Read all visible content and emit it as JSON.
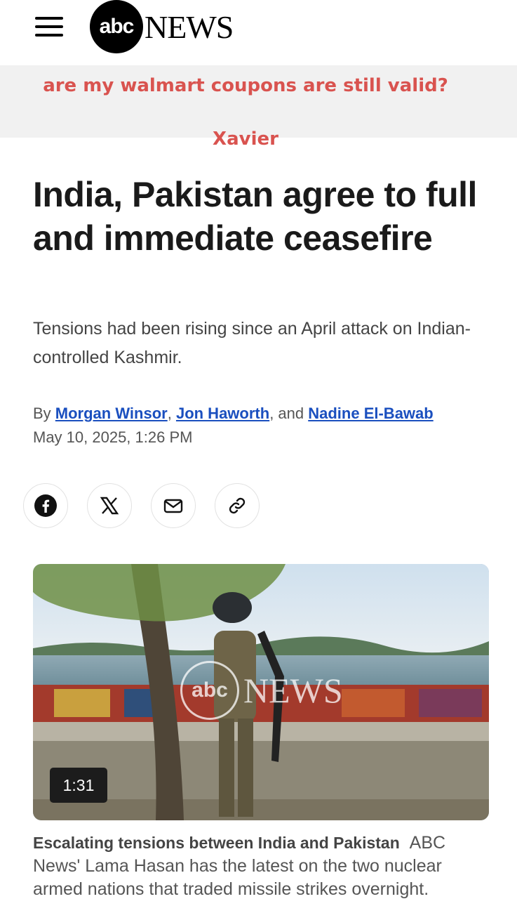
{
  "header": {
    "logo_abc": "abc",
    "logo_news": "NEWS"
  },
  "banner": {
    "question": "are my walmart coupons are still valid?",
    "name": "Xavier"
  },
  "article": {
    "headline": "India, Pakistan agree to full and immediate ceasefire",
    "dek": "Tensions had been rising since an April attack on Indian-controlled Kashmir.",
    "byline_prefix": "By ",
    "authors": [
      "Morgan Winsor",
      "Jon Haworth",
      "Nadine El-Bawab"
    ],
    "sep1": ", ",
    "sep2": ", and ",
    "date": "May 10, 2025, 1:26 PM"
  },
  "share": {
    "icons": [
      "facebook-icon",
      "x-icon",
      "email-icon",
      "link-icon"
    ]
  },
  "video": {
    "duration": "1:31",
    "watermark_abc": "abc",
    "watermark_news": "NEWS"
  },
  "caption": {
    "title": "Escalating tensions between India and Pakistan",
    "text": "ABC News' Lama Hasan has the latest on the two nuclear armed nations that traded missile strikes overnight."
  },
  "colors": {
    "banner_text": "#d9534f",
    "link": "#1a4fbf"
  }
}
